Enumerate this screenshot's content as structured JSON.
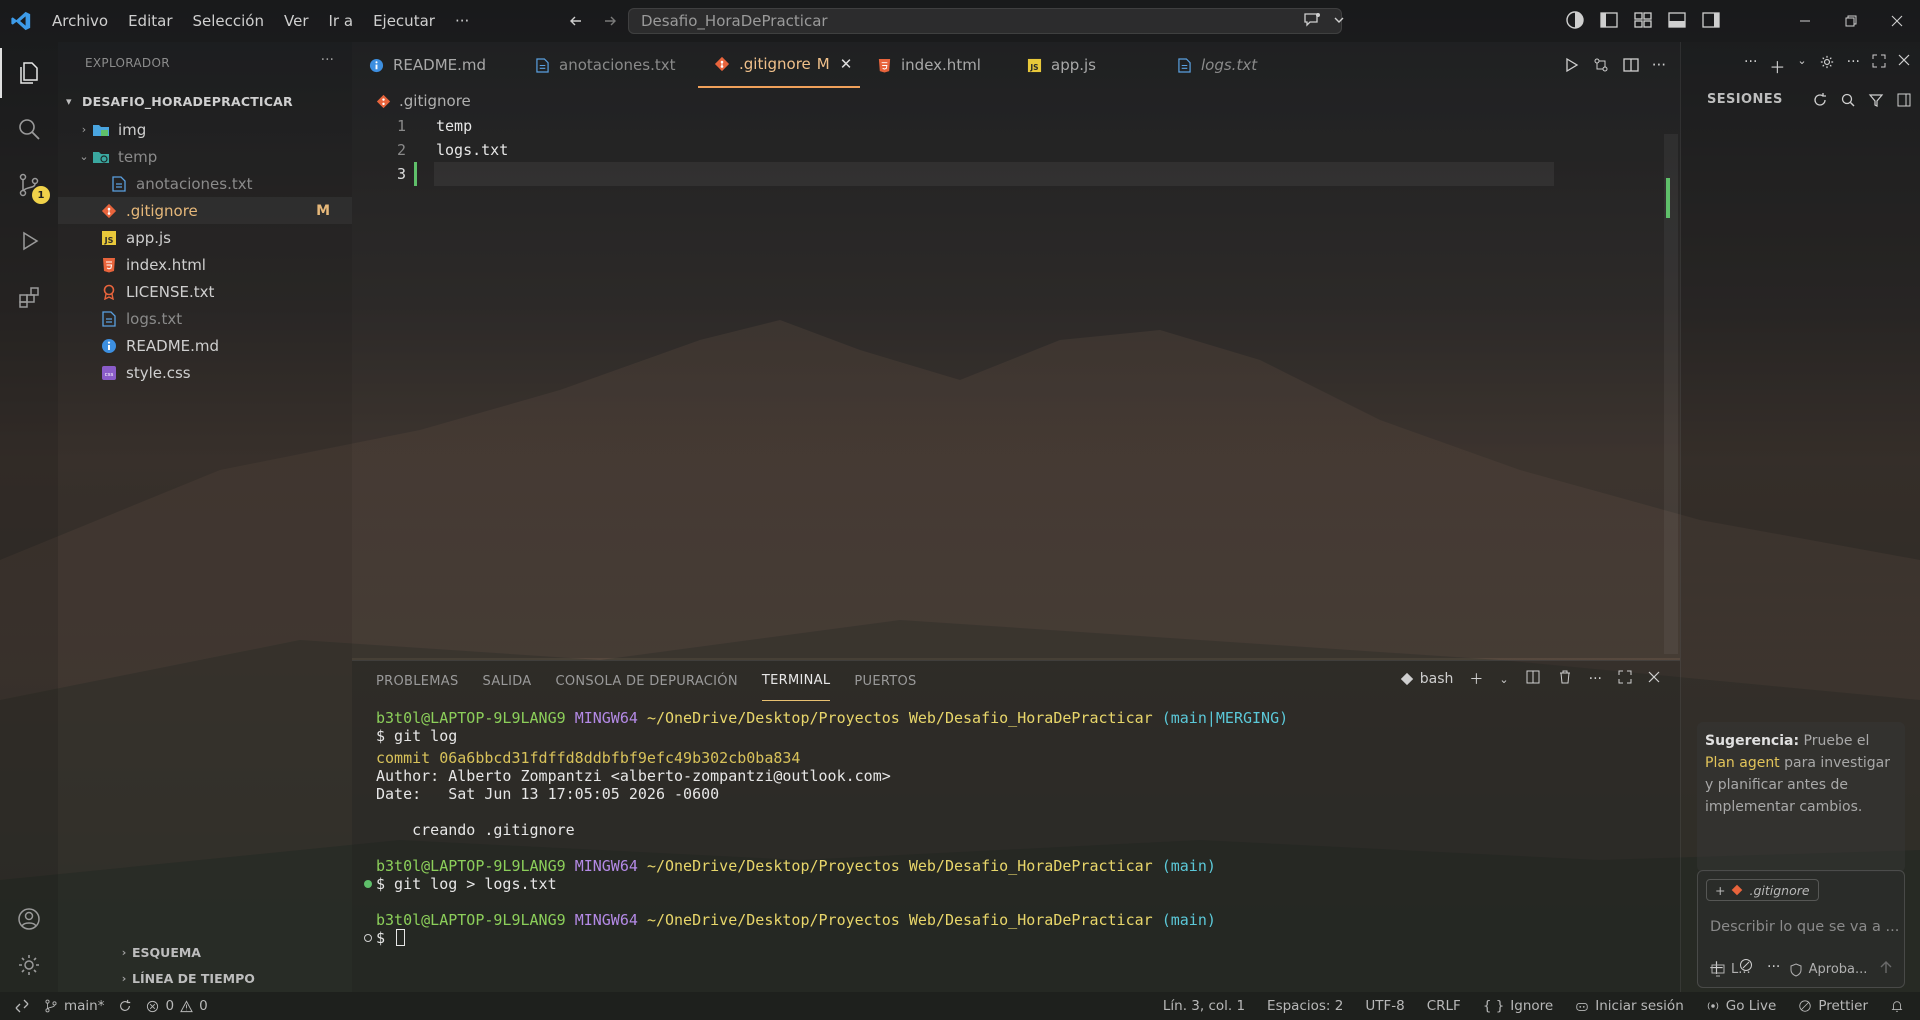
{
  "titlebar": {
    "menu": [
      "Archivo",
      "Editar",
      "Selección",
      "Ver",
      "Ir a",
      "Ejecutar",
      "···"
    ],
    "search_text": "Desafio_HoraDePracticar"
  },
  "activitybar": {
    "source_control_badge": "1"
  },
  "explorer": {
    "title": "EXPLORADOR",
    "more": "···",
    "project": "DESAFIO_HORADEPRACTICAR",
    "items": [
      {
        "name": "img",
        "icon": "folder-image-icon"
      },
      {
        "name": "temp",
        "icon": "folder-temp-icon"
      },
      {
        "name": "anotaciones.txt",
        "icon": "text-file-icon"
      },
      {
        "name": ".gitignore",
        "icon": "git-icon",
        "badge": "M"
      },
      {
        "name": "app.js",
        "icon": "js-file-icon"
      },
      {
        "name": "index.html",
        "icon": "html-file-icon"
      },
      {
        "name": "LICENSE.txt",
        "icon": "license-icon"
      },
      {
        "name": "logs.txt",
        "icon": "text-file-icon"
      },
      {
        "name": "README.md",
        "icon": "info-icon"
      },
      {
        "name": "style.css",
        "icon": "css-file-icon"
      }
    ],
    "outline": "ESQUEMA",
    "timeline": "LÍNEA DE TIEMPO"
  },
  "editor": {
    "tabs": [
      {
        "label": "README.md",
        "icon": "info-icon"
      },
      {
        "label": "anotaciones.txt",
        "icon": "text-file-icon"
      },
      {
        "label": ".gitignore",
        "icon": "git-icon",
        "modified": "M"
      },
      {
        "label": "index.html",
        "icon": "html-file-icon"
      },
      {
        "label": "app.js",
        "icon": "js-file-icon"
      },
      {
        "label": "logs.txt",
        "icon": "text-file-icon"
      }
    ],
    "breadcrumb": ".gitignore",
    "lines": [
      {
        "num": "1",
        "text": "temp"
      },
      {
        "num": "2",
        "text": "logs.txt"
      },
      {
        "num": "3",
        "text": ""
      }
    ]
  },
  "panel": {
    "tabs": [
      "PROBLEMAS",
      "SALIDA",
      "CONSOLA DE DEPURACIÓN",
      "TERMINAL",
      "PUERTOS"
    ],
    "shell": "bash",
    "terminal": {
      "user": "b3t0l@LAPTOP-9L9LANG9",
      "env": "MINGW64",
      "path": "~/OneDrive/Desktop/Proyectos Web/Desafio_HoraDePracticar",
      "branch_merging": "(main|MERGING)",
      "branch": "(main)",
      "cmd1": "$ git log",
      "commit": "commit 06a6bbcd31fdffd8ddbfbf9efc49b302cb0ba834",
      "author": "Author: Alberto Zompantzi <alberto-zompantzi@outlook.com>",
      "date": "Date:   Sat Jun 13 17:05:05 2026 -0600",
      "message": "    creando .gitignore",
      "cmd2": "$ git log > logs.txt",
      "prompt": "$ "
    }
  },
  "chat": {
    "sessions_title": "SESIONES",
    "suggestion_label": "Sugerencia:",
    "suggestion_pre": " Pruebe el ",
    "suggestion_link": "Plan agent",
    "suggestion_post": " para investigar y planificar antes de implementar cambios.",
    "context_chip": ".gitignore",
    "input_placeholder": "Describir lo que se va a ...",
    "footer_left": "L...",
    "footer_right": "Aproba..."
  },
  "statusbar": {
    "branch": "main*",
    "errors": "0",
    "warnings": "0",
    "position": "Lín. 3, col. 1",
    "spaces": "Espacios: 2",
    "encoding": "UTF-8",
    "eol": "CRLF",
    "language": "Ignore",
    "signin": "Iniciar sesión",
    "golive": "Go Live",
    "prettier": "Prettier"
  },
  "colors": {
    "accent_tab": "#f0a05a",
    "modified": "#e6b87a",
    "git_orange": "#e8643c",
    "term_green": "#8ccf5a",
    "term_purple": "#b48ae6",
    "term_yellow": "#e8d66a",
    "term_cyan": "#5bc8d8"
  }
}
